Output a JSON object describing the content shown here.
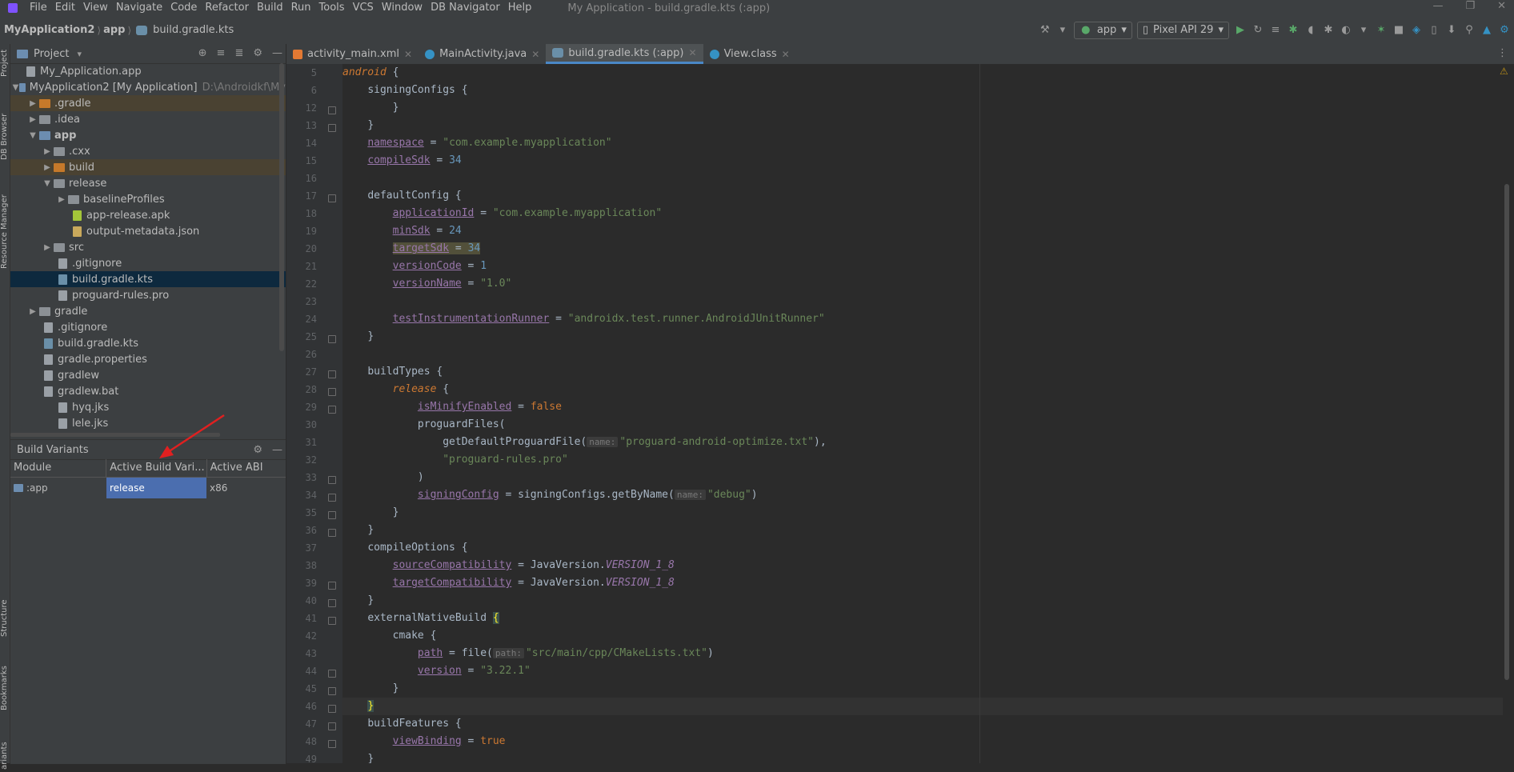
{
  "menubar": {
    "items": [
      "File",
      "Edit",
      "View",
      "Navigate",
      "Code",
      "Refactor",
      "Build",
      "Run",
      "Tools",
      "VCS",
      "Window",
      "DB Navigator",
      "Help"
    ],
    "window_title": "My Application - build.gradle.kts (:app)"
  },
  "breadcrumb": {
    "project": "MyApplication2",
    "module": "app",
    "file": "build.gradle.kts"
  },
  "toolbar": {
    "config": "app",
    "device": "Pixel API 29"
  },
  "side_tabs": {
    "project": "Project",
    "db_browser": "DB Browser",
    "resource_manager": "Resource Manager",
    "structure": "Structure",
    "bookmarks": "Bookmarks",
    "variants": "ariants"
  },
  "project_panel": {
    "title": "Project",
    "tree": [
      {
        "label": "My_Application.app",
        "extra": ""
      },
      {
        "label": "MyApplication2 [My Application]",
        "extra": "D:\\Androidkf\\My"
      },
      {
        "label": ".gradle",
        "extra": ""
      },
      {
        "label": ".idea",
        "extra": ""
      },
      {
        "label": "app",
        "extra": ""
      },
      {
        "label": ".cxx",
        "extra": ""
      },
      {
        "label": "build",
        "extra": ""
      },
      {
        "label": "release",
        "extra": ""
      },
      {
        "label": "baselineProfiles",
        "extra": ""
      },
      {
        "label": "app-release.apk",
        "extra": ""
      },
      {
        "label": "output-metadata.json",
        "extra": ""
      },
      {
        "label": "src",
        "extra": ""
      },
      {
        "label": ".gitignore",
        "extra": ""
      },
      {
        "label": "build.gradle.kts",
        "extra": ""
      },
      {
        "label": "proguard-rules.pro",
        "extra": ""
      },
      {
        "label": "gradle",
        "extra": ""
      },
      {
        "label": ".gitignore",
        "extra": ""
      },
      {
        "label": "build.gradle.kts",
        "extra": ""
      },
      {
        "label": "gradle.properties",
        "extra": ""
      },
      {
        "label": "gradlew",
        "extra": ""
      },
      {
        "label": "gradlew.bat",
        "extra": ""
      },
      {
        "label": "hyq.jks",
        "extra": ""
      },
      {
        "label": "lele.jks",
        "extra": ""
      }
    ]
  },
  "build_variants": {
    "title": "Build Variants",
    "headers": [
      "Module",
      "Active Build Vari...",
      "Active ABI"
    ],
    "row": {
      "module": ":app",
      "variant": "release",
      "abi": "x86"
    }
  },
  "editor_tabs": [
    {
      "label": "activity_main.xml"
    },
    {
      "label": "MainActivity.java"
    },
    {
      "label": "build.gradle.kts (:app)"
    },
    {
      "label": "View.class"
    }
  ],
  "code": {
    "line_numbers": [
      "5",
      "6",
      "12",
      "13",
      "14",
      "15",
      "16",
      "17",
      "18",
      "19",
      "20",
      "21",
      "22",
      "23",
      "24",
      "25",
      "26",
      "27",
      "28",
      "29",
      "30",
      "31",
      "32",
      "33",
      "34",
      "35",
      "36",
      "37",
      "38",
      "39",
      "40",
      "41",
      "42",
      "43",
      "44",
      "45",
      "46",
      "47",
      "48",
      "49"
    ],
    "t": {
      "android": "android",
      "open": " {",
      "close": "}",
      "sc": "signingConfigs",
      "eq": " = ",
      "namespace": "namespace",
      "ns_val": "\"com.example.myapplication\"",
      "compileSdk": "compileSdk",
      "v34": "34",
      "defaultConfig": "defaultConfig",
      "applicationId": "applicationId",
      "app_id_val": "\"com.example.myapplication\"",
      "minSdk": "minSdk",
      "v24": "24",
      "targetSdk": "targetSdk",
      "versionCode": "versionCode",
      "v1": "1",
      "versionName": "versionName",
      "vn_val": "\"1.0\"",
      "tir": "testInstrumentationRunner",
      "tir_val": "\"androidx.test.runner.AndroidJUnitRunner\"",
      "buildTypes": "buildTypes",
      "release": "release",
      "isMinify": "isMinifyEnabled",
      "false": "false",
      "proguardFiles": "proguardFiles(",
      "getDefault": "getDefaultProguardFile(",
      "hint_name": "name:",
      "pao": "\"proguard-android-optimize.txt\"",
      "comma": ",",
      "pr": "\"proguard-rules.pro\"",
      "rparen": ")",
      "signingConfig": "signingConfig",
      "getByName": "signingConfigs.getByName(",
      "debug": "\"debug\"",
      "compileOptions": "compileOptions",
      "sourceCompat": "sourceCompatibility",
      "targetCompat": "targetCompatibility",
      "jv": "JavaVersion.",
      "v18": "VERSION_1_8",
      "externalNativeBuild": "externalNativeBuild",
      "cmake": "cmake",
      "path": "path",
      "file_call": "file(",
      "hint_path": "path:",
      "cmake_path": "\"src/main/cpp/CMakeLists.txt\"",
      "version": "version",
      "cmake_ver": "\"3.22.1\"",
      "buildFeatures": "buildFeatures",
      "viewBinding": "viewBinding",
      "true": "true"
    }
  },
  "colors": {
    "accent": "#4a88c7",
    "selection": "#4b6eaf",
    "background": "#2b2b2b",
    "panel": "#3c3f41"
  }
}
